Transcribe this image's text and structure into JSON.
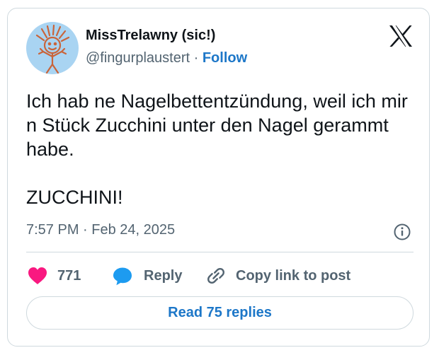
{
  "author": {
    "display_name": "MissTrelawny (sic!)",
    "handle": "@fingurplaustert",
    "separator": "·",
    "follow_label": "Follow",
    "avatar_icon": "stick-figure-drawing"
  },
  "brand_icon": "x-logo",
  "tweet": {
    "lines": [
      "Ich hab ne Nagelbettentzündung, weil ich mir n Stück Zucchini unter den Nagel gerammt habe.",
      "ZUCCHINI!"
    ],
    "timestamp": "7:57 PM · Feb 24, 2025"
  },
  "actions": {
    "like_count": "771",
    "reply_label": "Reply",
    "copy_label": "Copy link to post"
  },
  "read_replies_label": "Read 75 replies",
  "colors": {
    "accent": "#1d77c8",
    "like": "#f91880",
    "reply_bubble": "#1d9bf0",
    "secondary_text": "#536471",
    "border": "#cfd9de"
  }
}
